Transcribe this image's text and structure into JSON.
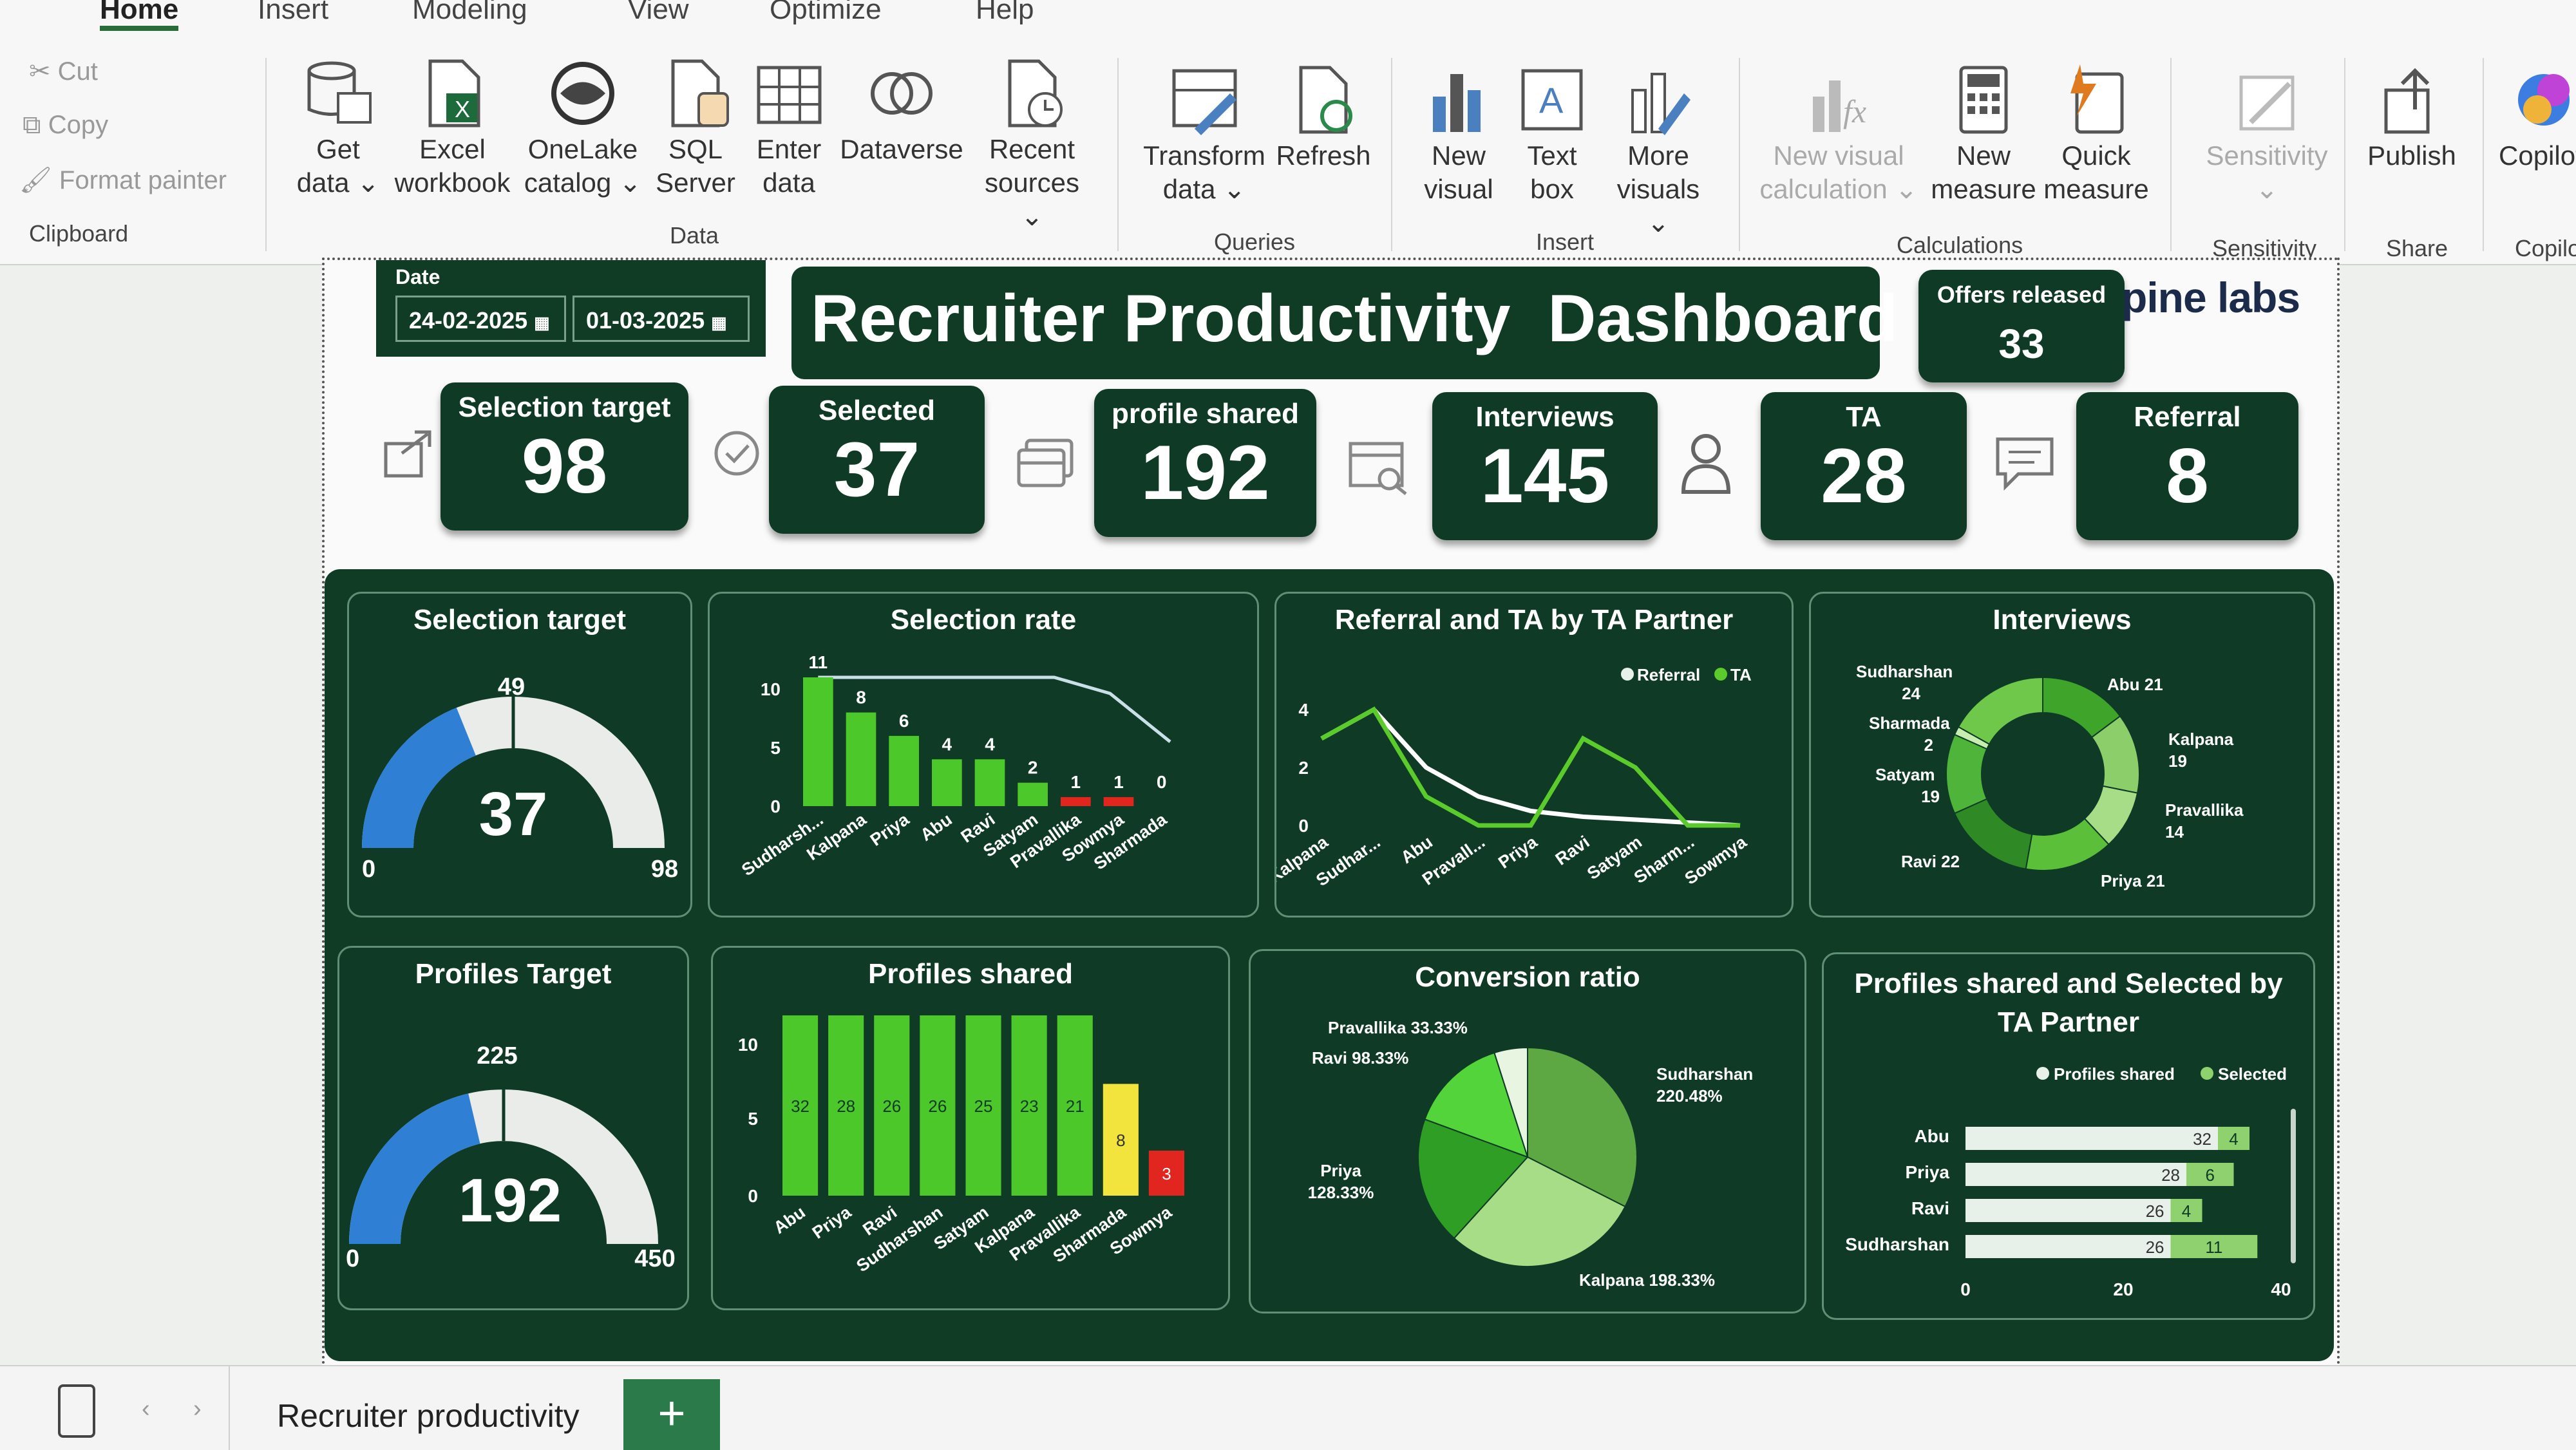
{
  "ribbon": {
    "tabs": [
      "Home",
      "Insert",
      "Modeling",
      "View",
      "Optimize",
      "Help"
    ],
    "clipboard": {
      "cut": "Cut",
      "copy": "Copy",
      "format_painter": "Format painter",
      "label": "Clipboard"
    },
    "data": {
      "get_data": "Get data",
      "excel": "Excel workbook",
      "onelake": "OneLake catalog",
      "sql": "SQL Server",
      "enter": "Enter data",
      "dataverse": "Dataverse",
      "recent": "Recent sources",
      "label": "Data"
    },
    "queries": {
      "transform": "Transform data",
      "refresh": "Refresh",
      "label": "Queries"
    },
    "insert": {
      "new_visual": "New visual",
      "text_box": "Text box",
      "more_visuals": "More visuals",
      "label": "Insert"
    },
    "calculations": {
      "new_visual_calc": "New visual calculation",
      "new_measure": "New measure",
      "quick_measure": "Quick measure",
      "label": "Calculations"
    },
    "sensitivity": {
      "btn": "Sensitivity",
      "label": "Sensitivity"
    },
    "share": {
      "publish": "Publish",
      "label": "Share"
    },
    "copilot": {
      "btn": "Copilot",
      "label": "Copilot"
    }
  },
  "header": {
    "date_label": "Date",
    "date_from": "24-02-2025",
    "date_to": "01-03-2025",
    "title": "Recruiter Productivity  Dashboard",
    "offers_label": "Offers released",
    "offers_value": "33",
    "logo": "pine labs"
  },
  "kpis": [
    {
      "label": "Selection target",
      "value": "98"
    },
    {
      "label": "Selected",
      "value": "37"
    },
    {
      "label": "profile shared",
      "value": "192"
    },
    {
      "label": "Interviews",
      "value": "145"
    },
    {
      "label": "TA",
      "value": "28"
    },
    {
      "label": "Referral",
      "value": "8"
    }
  ],
  "gauge_selection": {
    "title": "Selection target",
    "value": 37,
    "target": 49,
    "min": 0,
    "max": 98,
    "value_text": "37",
    "target_text": "49",
    "min_text": "0",
    "max_text": "98"
  },
  "gauge_profiles": {
    "title": "Profiles Target",
    "value": 192,
    "target": 225,
    "min": 0,
    "max": 450,
    "value_text": "192",
    "target_text": "225",
    "min_text": "0",
    "max_text": "450"
  },
  "chart_data": [
    {
      "type": "bar",
      "title": "Selection rate",
      "categories": [
        "Sudharsh...",
        "Kalpana",
        "Priya",
        "Abu",
        "Ravi",
        "Satyam",
        "Pravallika",
        "Sowmya",
        "Sharmada"
      ],
      "values": [
        11,
        8,
        6,
        4,
        4,
        2,
        1,
        1,
        0
      ],
      "ylim": [
        0,
        11
      ],
      "yticks": [
        "0",
        "5",
        "10"
      ],
      "colors": {
        "high": "#4cc82a",
        "low": "#e0261e"
      }
    },
    {
      "type": "line",
      "title": "Referral and TA by TA Partner",
      "categories": [
        "Kalpana",
        "Sudhar...",
        "Abu",
        "Pravall...",
        "Priya",
        "Ravi",
        "Satyam",
        "Sharm...",
        "Sowmya"
      ],
      "series": [
        {
          "name": "Referral",
          "values": [
            3,
            4,
            2,
            1,
            0.5,
            0.3,
            0.2,
            0.1,
            0
          ]
        },
        {
          "name": "TA",
          "values": [
            3,
            4,
            1,
            0,
            0,
            3,
            2,
            0,
            0
          ]
        }
      ],
      "ylim": [
        0,
        4
      ],
      "yticks": [
        "0",
        "2",
        "4"
      ],
      "legend": "top-right"
    },
    {
      "type": "pie",
      "title": "Interviews",
      "donut": true,
      "labels": [
        "Abu",
        "Kalpana",
        "Pravallika",
        "Priya",
        "Ravi",
        "Satyam",
        "Sharmada",
        "Sudharshan"
      ],
      "values": [
        21,
        19,
        14,
        21,
        22,
        19,
        2,
        24
      ],
      "display": [
        "Abu 21",
        "Kalpana 19",
        "Pravallika 14",
        "Priya 21",
        "Ravi 22",
        "Satyam 19",
        "Sharmada 2",
        "Sudharshan 24"
      ]
    },
    {
      "type": "bar",
      "title": "Profiles shared",
      "categories": [
        "Abu",
        "Priya",
        "Ravi",
        "Sudharshan",
        "Satyam",
        "Kalpana",
        "Pravallika",
        "Sharmada",
        "Sowmya"
      ],
      "values": [
        32,
        28,
        26,
        26,
        25,
        23,
        21,
        8,
        3
      ],
      "ylim": [
        0,
        32
      ],
      "yticks": [
        "0",
        "5",
        "10"
      ],
      "colors": {
        "high": "#4cc82a",
        "mid": "#f2e43c",
        "low": "#e0261e"
      }
    },
    {
      "type": "pie",
      "title": "Conversion ratio",
      "labels": [
        "Sudharshan",
        "Kalpana",
        "Priya",
        "Ravi",
        "Pravallika"
      ],
      "values": [
        220.48,
        198.33,
        128.33,
        98.33,
        33.33
      ],
      "display": [
        "Sudharshan 220.48%",
        "Kalpana 198.33%",
        "Priya 128.33%",
        "Ravi 98.33%",
        "Pravallika 33.33%"
      ]
    },
    {
      "type": "bar",
      "title": "Profiles shared and Selected by TA Partner",
      "orientation": "horizontal",
      "stacked": true,
      "categories": [
        "Abu",
        "Priya",
        "Ravi",
        "Sudharshan"
      ],
      "series": [
        {
          "name": "Profiles shared",
          "values": [
            32,
            28,
            26,
            26
          ]
        },
        {
          "name": "Selected",
          "values": [
            4,
            6,
            4,
            11
          ]
        }
      ],
      "xlim": [
        0,
        40
      ],
      "xticks": [
        "0",
        "20",
        "40"
      ],
      "legend": "top"
    }
  ],
  "bottom": {
    "page_tab": "Recruiter productivity",
    "add_page": "+"
  }
}
